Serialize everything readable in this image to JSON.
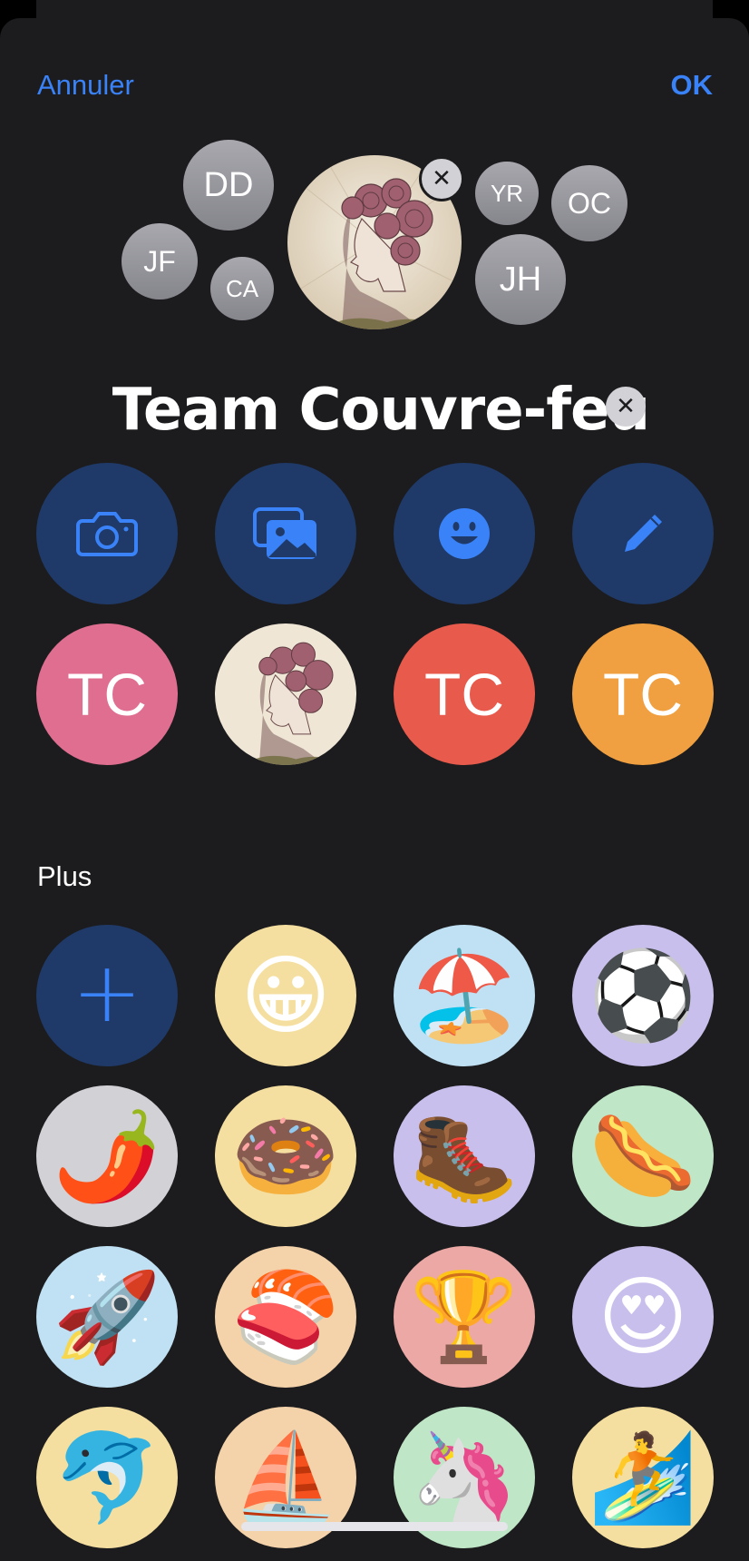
{
  "nav": {
    "cancel_label": "Annuler",
    "ok_label": "OK"
  },
  "members": [
    {
      "initials": "DD"
    },
    {
      "initials": "JF"
    },
    {
      "initials": "CA"
    },
    {
      "initials": "YR"
    },
    {
      "initials": "OC"
    },
    {
      "initials": "JH"
    }
  ],
  "group_name": "Team Couvre-feu",
  "clear_glyph": "✕",
  "actions": [
    {
      "icon": "camera-icon"
    },
    {
      "icon": "photos-icon"
    },
    {
      "icon": "emoji-icon"
    },
    {
      "icon": "pencil-icon"
    }
  ],
  "suggestions": [
    {
      "label": "TC",
      "color": "#e06e90"
    },
    {
      "label": "",
      "type": "photo"
    },
    {
      "label": "TC",
      "color": "#e85a4c"
    },
    {
      "label": "TC",
      "color": "#f0a040"
    }
  ],
  "more_section": {
    "title": "Plus",
    "add_glyph": "+",
    "emojis": [
      {
        "emoji": "😀",
        "bg": "#f5dfa0"
      },
      {
        "emoji": "🏖️",
        "bg": "#bfe1f3"
      },
      {
        "emoji": "⚽",
        "bg": "#c9bfec"
      },
      {
        "emoji": "🌶️",
        "bg": "#d1d1d6"
      },
      {
        "emoji": "🍩",
        "bg": "#f5dfa0"
      },
      {
        "emoji": "🥾",
        "bg": "#c9bfec"
      },
      {
        "emoji": "🌭",
        "bg": "#bfe6c6"
      },
      {
        "emoji": "🚀",
        "bg": "#bfe1f3"
      },
      {
        "emoji": "🍣",
        "bg": "#f5d3aa"
      },
      {
        "emoji": "🏆",
        "bg": "#eba8a4"
      },
      {
        "emoji": "😍",
        "bg": "#c9bfec"
      },
      {
        "emoji": "🐬",
        "bg": "#f5dfa0"
      },
      {
        "emoji": "⛵",
        "bg": "#f5d3aa"
      },
      {
        "emoji": "🦄",
        "bg": "#bfe6c6"
      },
      {
        "emoji": "🏄",
        "bg": "#f5dfa0"
      }
    ]
  },
  "colors": {
    "accent": "#3a82f7",
    "sheet_bg": "#1c1c1e",
    "button_bg": "#1f3a68"
  }
}
